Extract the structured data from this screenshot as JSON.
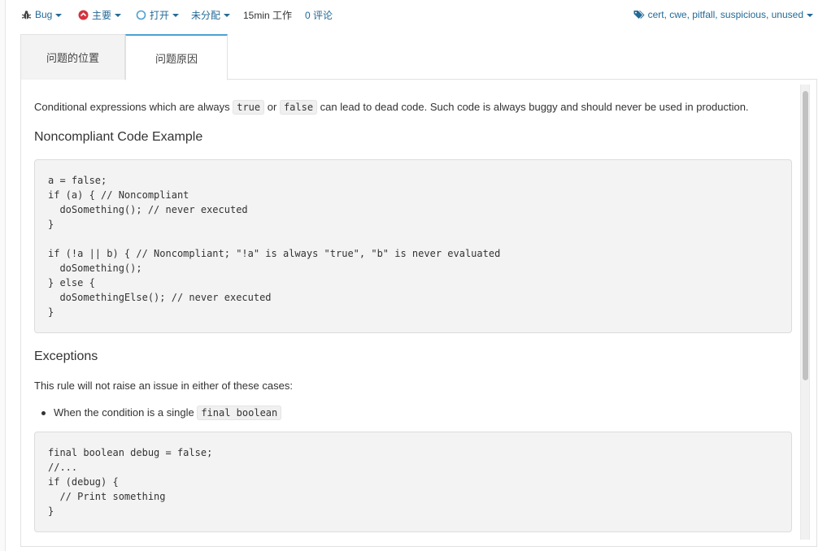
{
  "header": {
    "type_label": "Bug",
    "severity_label": "主要",
    "status_label": "打开",
    "assignee_label": "未分配",
    "effort": "15min 工作",
    "comments": "0 评论",
    "tags": "cert, cwe, pitfall, suspicious, unused",
    "colors": {
      "link": "#236a97",
      "severity": "#d4333f",
      "tab_accent": "#4b9fd5"
    }
  },
  "tabs": [
    {
      "label": "问题的位置",
      "active": false
    },
    {
      "label": "问题原因",
      "active": true
    }
  ],
  "rule": {
    "intro": {
      "before": "Conditional expressions which are always ",
      "code1": "true",
      "mid": " or ",
      "code2": "false",
      "after": " can lead to dead code. Such code is always buggy and should never be used in production."
    },
    "noncompliant_title": "Noncompliant Code Example",
    "noncompliant_code": "a = false;\nif (a) { // Noncompliant\n  doSomething(); // never executed\n}\n\nif (!a || b) { // Noncompliant; \"!a\" is always \"true\", \"b\" is never evaluated\n  doSomething();\n} else {\n  doSomethingElse(); // never executed\n}",
    "exceptions_title": "Exceptions",
    "exceptions_text": "This rule will not raise an issue in either of these cases:",
    "exceptions_item": {
      "text": "When the condition is a single ",
      "code": "final boolean"
    },
    "exception_code": "final boolean debug = false;\n//...\nif (debug) {\n  // Print something\n}"
  }
}
